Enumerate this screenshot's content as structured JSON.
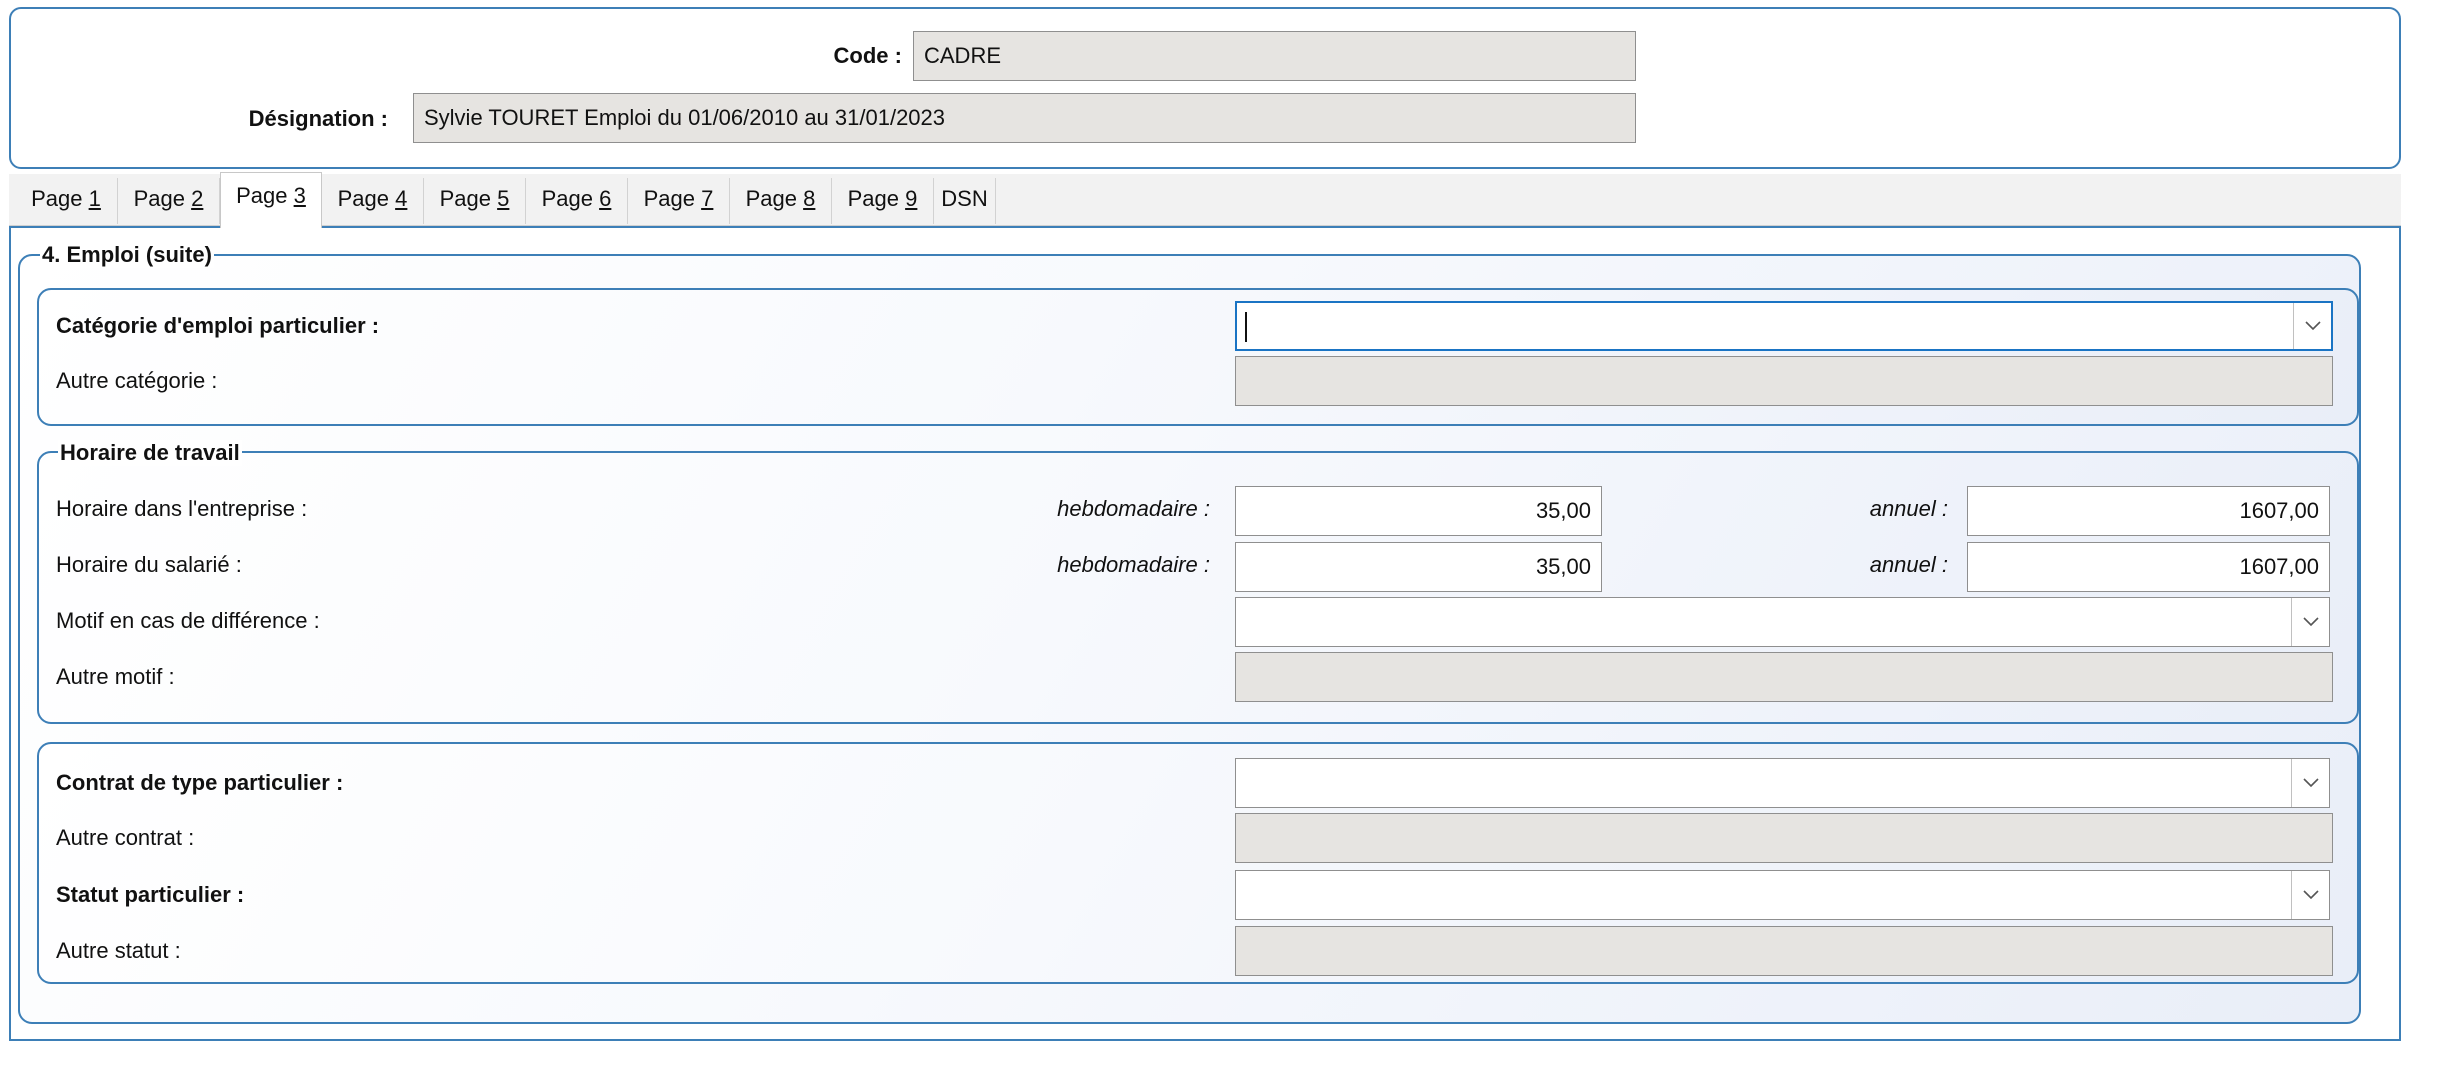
{
  "header": {
    "code_label": "Code :",
    "code_value": "CADRE",
    "designation_label": "Désignation :",
    "designation_value": "Sylvie TOURET Emploi du 01/06/2010 au 31/01/2023"
  },
  "tabs": [
    {
      "prefix": "Page ",
      "key": "1",
      "active": false
    },
    {
      "prefix": "Page ",
      "key": "2",
      "active": false
    },
    {
      "prefix": "Page ",
      "key": "3",
      "active": true
    },
    {
      "prefix": "Page ",
      "key": "4",
      "active": false
    },
    {
      "prefix": "Page ",
      "key": "5",
      "active": false
    },
    {
      "prefix": "Page ",
      "key": "6",
      "active": false
    },
    {
      "prefix": "Page ",
      "key": "7",
      "active": false
    },
    {
      "prefix": "Page ",
      "key": "8",
      "active": false
    },
    {
      "prefix": "Page ",
      "key": "9",
      "active": false
    },
    {
      "prefix": "DSN",
      "key": "",
      "active": false
    }
  ],
  "section": {
    "title": "4. Emploi (suite)",
    "categorie": {
      "label": "Catégorie d'emploi particulier :",
      "value": "",
      "autre_label": "Autre catégorie :",
      "autre_value": ""
    },
    "horaire": {
      "title": "Horaire de travail",
      "entreprise_label": "Horaire dans l'entreprise :",
      "salarie_label": "Horaire du salarié :",
      "hebdo_label": "hebdomadaire :",
      "annuel_label": "annuel :",
      "entreprise_hebdo": "35,00",
      "entreprise_annuel": "1607,00",
      "salarie_hebdo": "35,00",
      "salarie_annuel": "1607,00",
      "motif_label": "Motif en cas de différence :",
      "motif_value": "",
      "autre_motif_label": "Autre motif :",
      "autre_motif_value": ""
    },
    "contrat": {
      "contrat_label": "Contrat de type particulier :",
      "contrat_value": "",
      "autre_contrat_label": "Autre contrat :",
      "autre_contrat_value": "",
      "statut_label": "Statut particulier :",
      "statut_value": "",
      "autre_statut_label": "Autre statut :",
      "autre_statut_value": ""
    }
  },
  "icons": {
    "dropdown": "chevron-down-icon"
  },
  "colors": {
    "accent_border": "#3d7fb7",
    "focus_border": "#1a74c4",
    "readonly_bg": "#e6e4e1"
  }
}
